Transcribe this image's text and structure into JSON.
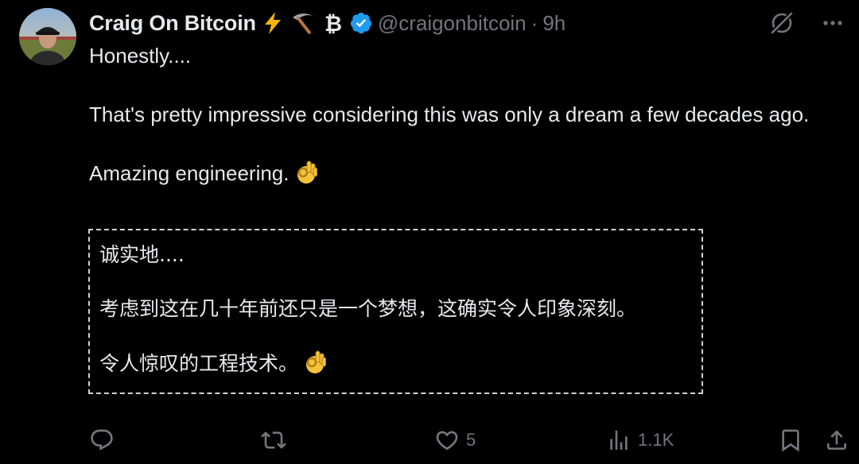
{
  "author": {
    "display_name": "Craig On Bitcoin",
    "badges": [
      "lightning-icon",
      "pickaxe-icon",
      "bitcoin-icon"
    ],
    "verified": true,
    "handle": "@craigonbitcoin",
    "separator": "·",
    "time": "9h"
  },
  "tweet": {
    "line1": "Honestly....",
    "line2": "That's pretty impressive considering this was only a dream a few decades ago.",
    "line3": "Amazing engineering.",
    "line3_emoji": "ok-hand-emoji"
  },
  "translation": {
    "line1": "诚实地....",
    "line2": "考虑到这在几十年前还只是一个梦想，这确实令人印象深刻。",
    "line3": "令人惊叹的工程技术。",
    "line3_emoji": "ok-hand-emoji"
  },
  "actions": {
    "reply_count": "",
    "retweet_count": "",
    "like_count": "5",
    "views_count": "1.1K"
  },
  "colors": {
    "background": "#000000",
    "text": "#e7e9ea",
    "muted": "#71767b",
    "verified_blue": "#1d9bf0",
    "lightning": "#f6b400",
    "bitcoin": "#e7e9ea"
  }
}
